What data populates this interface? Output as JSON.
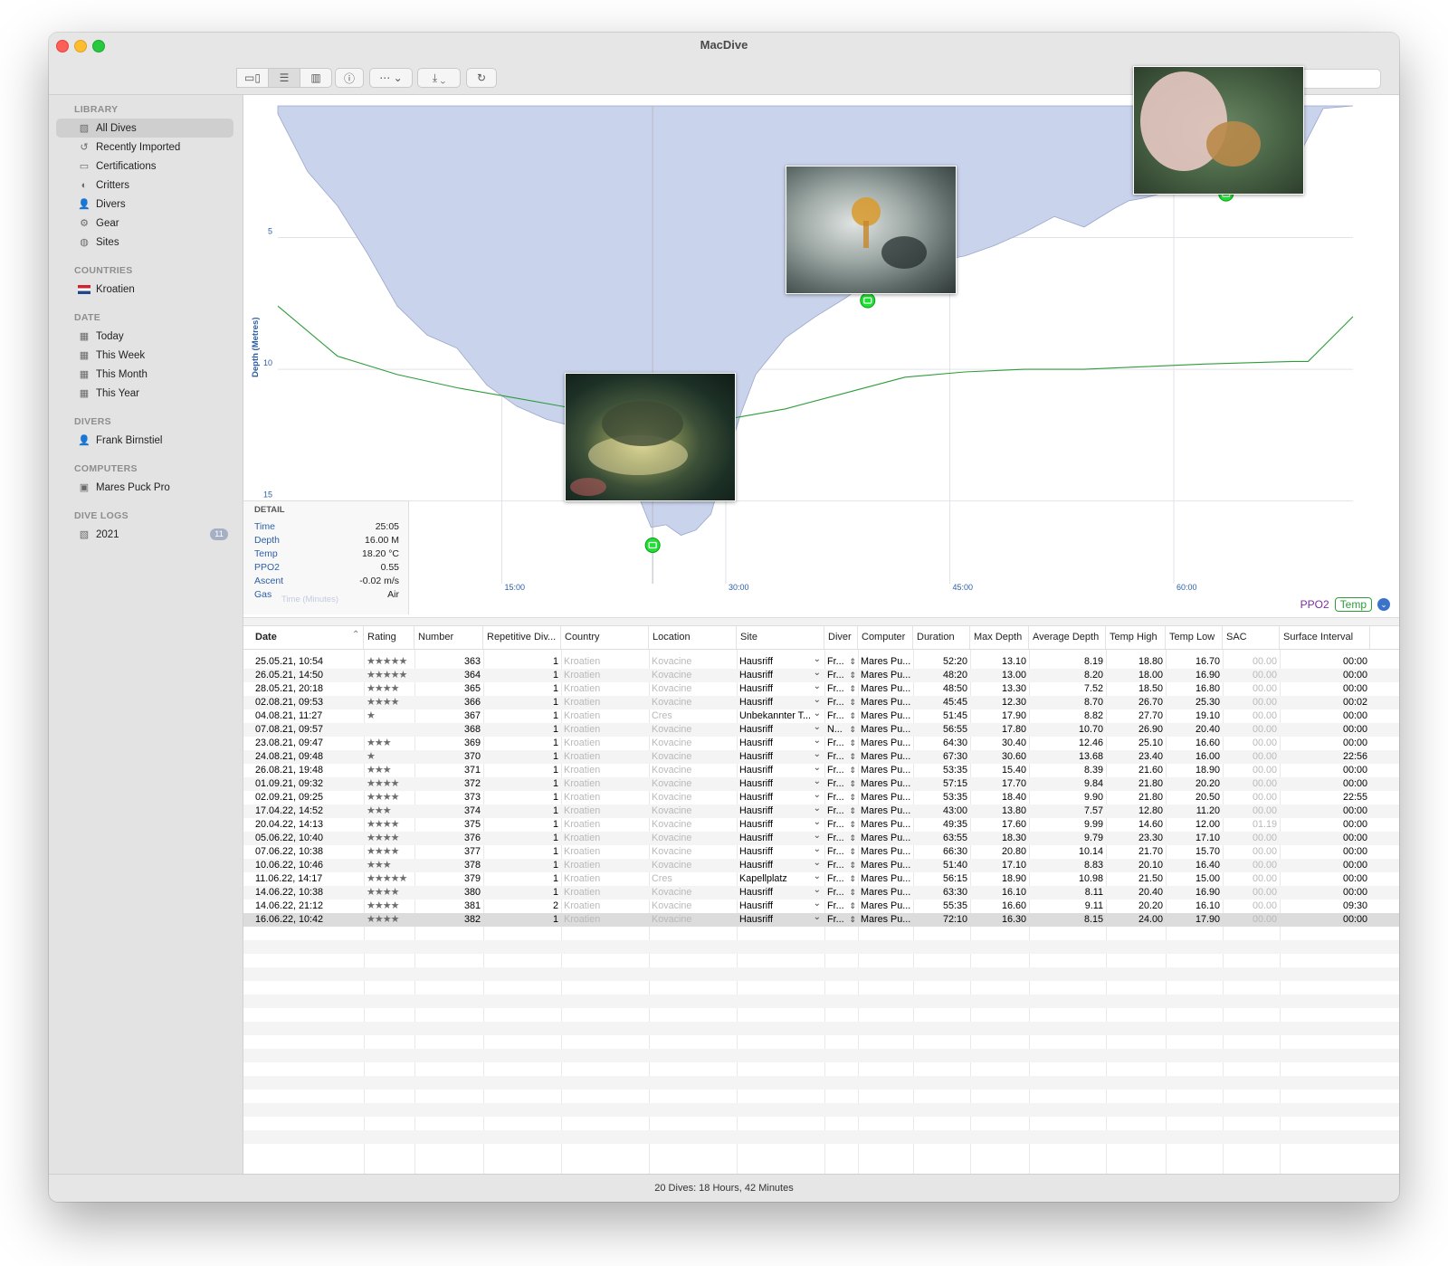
{
  "window": {
    "title": "MacDive"
  },
  "sidebar": {
    "sections": [
      {
        "title": "LIBRARY",
        "items": [
          {
            "label": "All Dives",
            "icon": "book-icon",
            "selected": true
          },
          {
            "label": "Recently Imported",
            "icon": "import-icon"
          },
          {
            "label": "Certifications",
            "icon": "card-icon"
          },
          {
            "label": "Critters",
            "icon": "fish-icon"
          },
          {
            "label": "Divers",
            "icon": "person-icon"
          },
          {
            "label": "Gear",
            "icon": "gear-icon"
          },
          {
            "label": "Sites",
            "icon": "globe-icon"
          }
        ]
      },
      {
        "title": "COUNTRIES",
        "items": [
          {
            "label": "Kroatien",
            "icon": "flag-icon"
          }
        ]
      },
      {
        "title": "DATE",
        "items": [
          {
            "label": "Today",
            "icon": "calendar-icon"
          },
          {
            "label": "This Week",
            "icon": "calendar-icon"
          },
          {
            "label": "This Month",
            "icon": "calendar-icon"
          },
          {
            "label": "This Year",
            "icon": "calendar-icon"
          }
        ]
      },
      {
        "title": "DIVERS",
        "items": [
          {
            "label": "Frank Birnstiel",
            "icon": "person-icon"
          }
        ]
      },
      {
        "title": "COMPUTERS",
        "items": [
          {
            "label": "Mares Puck Pro",
            "icon": "dive-computer-icon"
          }
        ]
      },
      {
        "title": "DIVE LOGS",
        "items": [
          {
            "label": "2021",
            "icon": "book-icon",
            "badge": "11"
          }
        ]
      }
    ]
  },
  "chart": {
    "ylabel": "Depth (Metres)",
    "xlabel": "Time (Minutes)",
    "legend": {
      "ppo2": "PPO2",
      "temp": "Temp"
    }
  },
  "chart_data": {
    "type": "area",
    "xlabel": "Time (Minutes)",
    "ylabel": "Depth (Metres)",
    "x_ticks": [
      "15:00",
      "30:00",
      "45:00",
      "60:00"
    ],
    "x_range": [
      0,
      72
    ],
    "y_ticks": [
      "5",
      "10",
      "15"
    ],
    "y_range": [
      0,
      18
    ],
    "y_inverted": true,
    "series": [
      {
        "name": "Depth",
        "color": "#c9d3ec",
        "x": [
          0,
          2,
          4,
          6,
          8,
          10,
          12,
          14,
          16,
          18,
          20,
          22,
          24,
          25,
          26,
          27,
          28,
          29,
          30,
          31,
          32,
          34,
          36,
          38,
          40,
          42,
          44,
          46,
          48,
          50,
          52,
          54,
          56,
          57,
          58,
          60,
          62,
          64,
          66,
          68,
          70,
          72
        ],
        "y": [
          0.3,
          2.5,
          3.8,
          5.6,
          7.6,
          8.7,
          9.2,
          10.6,
          11.4,
          11.9,
          12.2,
          12.6,
          14.6,
          16.0,
          15.9,
          16.3,
          16.1,
          15.5,
          13.5,
          11.7,
          10.2,
          8.8,
          8.0,
          7.3,
          6.5,
          6.2,
          5.9,
          5.7,
          5.3,
          4.8,
          4.2,
          4.6,
          3.9,
          3.6,
          3.5,
          3.2,
          2.8,
          2.6,
          2.4,
          2.3,
          0.1,
          0.0
        ]
      },
      {
        "name": "Temp",
        "color": "#2e9c3a",
        "x": [
          0,
          4,
          8,
          12,
          16,
          20,
          24,
          28,
          30,
          34,
          38,
          42,
          46,
          50,
          54,
          58,
          62,
          68,
          69,
          72
        ],
        "y": [
          7.6,
          9.5,
          10.2,
          10.7,
          11.1,
          11.5,
          11.8,
          11.9,
          11.9,
          11.5,
          10.9,
          10.3,
          10.1,
          10.0,
          10.0,
          9.9,
          9.8,
          9.7,
          9.7,
          8.0
        ]
      }
    ],
    "cursor_x": 25.1,
    "photo_markers_x": [
      25.1,
      39.5,
      63.5
    ]
  },
  "detail": {
    "title": "DETAIL",
    "rows": [
      {
        "k": "Time",
        "v": "25:05"
      },
      {
        "k": "Depth",
        "v": "16.00 M"
      },
      {
        "k": "Temp",
        "v": "18.20 °C"
      },
      {
        "k": "PPO2",
        "v": "0.55"
      },
      {
        "k": "Ascent",
        "v": "-0.02 m/s"
      },
      {
        "k": "Gas",
        "v": "Air"
      }
    ]
  },
  "table": {
    "columns": [
      "Date",
      "Rating",
      "Number",
      "Repetitive Div...",
      "Country",
      "Location",
      "Site",
      "Diver",
      "Computer",
      "Duration",
      "Max Depth",
      "Average Depth",
      "Temp High",
      "Temp Low",
      "SAC",
      "Surface Interval"
    ],
    "rows": [
      [
        "25.05.21, 10:54",
        "★★★★★",
        "363",
        "1",
        "Kroatien",
        "Kovacine",
        "Hausriff",
        "Fr...",
        "Mares Pu...",
        "52:20",
        "13.10",
        "8.19",
        "18.80",
        "16.70",
        "00.00",
        "00:00"
      ],
      [
        "26.05.21, 14:50",
        "★★★★★",
        "364",
        "1",
        "Kroatien",
        "Kovacine",
        "Hausriff",
        "Fr...",
        "Mares Pu...",
        "48:20",
        "13.00",
        "8.20",
        "18.00",
        "16.90",
        "00.00",
        "00:00"
      ],
      [
        "28.05.21, 20:18",
        "★★★★",
        "365",
        "1",
        "Kroatien",
        "Kovacine",
        "Hausriff",
        "Fr...",
        "Mares Pu...",
        "48:50",
        "13.30",
        "7.52",
        "18.50",
        "16.80",
        "00.00",
        "00:00"
      ],
      [
        "02.08.21, 09:53",
        "★★★★",
        "366",
        "1",
        "Kroatien",
        "Kovacine",
        "Hausriff",
        "Fr...",
        "Mares Pu...",
        "45:45",
        "12.30",
        "8.70",
        "26.70",
        "25.30",
        "00.00",
        "00:02"
      ],
      [
        "04.08.21, 11:27",
        "★",
        "367",
        "1",
        "Kroatien",
        "Cres",
        "Unbekannter T...",
        "Fr...",
        "Mares Pu...",
        "51:45",
        "17.90",
        "8.82",
        "27.70",
        "19.10",
        "00.00",
        "00:00"
      ],
      [
        "07.08.21, 09:57",
        "",
        "368",
        "1",
        "Kroatien",
        "Kovacine",
        "Hausriff",
        "N...",
        "Mares Pu...",
        "56:55",
        "17.80",
        "10.70",
        "26.90",
        "20.40",
        "00.00",
        "00:00"
      ],
      [
        "23.08.21, 09:47",
        "★★★",
        "369",
        "1",
        "Kroatien",
        "Kovacine",
        "Hausriff",
        "Fr...",
        "Mares Pu...",
        "64:30",
        "30.40",
        "12.46",
        "25.10",
        "16.60",
        "00.00",
        "00:00"
      ],
      [
        "24.08.21, 09:48",
        "★",
        "370",
        "1",
        "Kroatien",
        "Kovacine",
        "Hausriff",
        "Fr...",
        "Mares Pu...",
        "67:30",
        "30.60",
        "13.68",
        "23.40",
        "16.00",
        "00.00",
        "22:56"
      ],
      [
        "26.08.21, 19:48",
        "★★★",
        "371",
        "1",
        "Kroatien",
        "Kovacine",
        "Hausriff",
        "Fr...",
        "Mares Pu...",
        "53:35",
        "15.40",
        "8.39",
        "21.60",
        "18.90",
        "00.00",
        "00:00"
      ],
      [
        "01.09.21, 09:32",
        "★★★★",
        "372",
        "1",
        "Kroatien",
        "Kovacine",
        "Hausriff",
        "Fr...",
        "Mares Pu...",
        "57:15",
        "17.70",
        "9.84",
        "21.80",
        "20.20",
        "00.00",
        "00:00"
      ],
      [
        "02.09.21, 09:25",
        "★★★★",
        "373",
        "1",
        "Kroatien",
        "Kovacine",
        "Hausriff",
        "Fr...",
        "Mares Pu...",
        "53:35",
        "18.40",
        "9.90",
        "21.80",
        "20.50",
        "00.00",
        "22:55"
      ],
      [
        "17.04.22, 14:52",
        "★★★",
        "374",
        "1",
        "Kroatien",
        "Kovacine",
        "Hausriff",
        "Fr...",
        "Mares Pu...",
        "43:00",
        "13.80",
        "7.57",
        "12.80",
        "11.20",
        "00.00",
        "00:00"
      ],
      [
        "20.04.22, 14:13",
        "★★★★",
        "375",
        "1",
        "Kroatien",
        "Kovacine",
        "Hausriff",
        "Fr...",
        "Mares Pu...",
        "49:35",
        "17.60",
        "9.99",
        "14.60",
        "12.00",
        "01.19",
        "00:00"
      ],
      [
        "05.06.22, 10:40",
        "★★★★",
        "376",
        "1",
        "Kroatien",
        "Kovacine",
        "Hausriff",
        "Fr...",
        "Mares Pu...",
        "63:55",
        "18.30",
        "9.79",
        "23.30",
        "17.10",
        "00.00",
        "00:00"
      ],
      [
        "07.06.22, 10:38",
        "★★★★",
        "377",
        "1",
        "Kroatien",
        "Kovacine",
        "Hausriff",
        "Fr...",
        "Mares Pu...",
        "66:30",
        "20.80",
        "10.14",
        "21.70",
        "15.70",
        "00.00",
        "00:00"
      ],
      [
        "10.06.22, 10:46",
        "★★★",
        "378",
        "1",
        "Kroatien",
        "Kovacine",
        "Hausriff",
        "Fr...",
        "Mares Pu...",
        "51:40",
        "17.10",
        "8.83",
        "20.10",
        "16.40",
        "00.00",
        "00:00"
      ],
      [
        "11.06.22, 14:17",
        "★★★★★",
        "379",
        "1",
        "Kroatien",
        "Cres",
        "Kapellplatz",
        "Fr...",
        "Mares Pu...",
        "56:15",
        "18.90",
        "10.98",
        "21.50",
        "15.00",
        "00.00",
        "00:00"
      ],
      [
        "14.06.22, 10:38",
        "★★★★",
        "380",
        "1",
        "Kroatien",
        "Kovacine",
        "Hausriff",
        "Fr...",
        "Mares Pu...",
        "63:30",
        "16.10",
        "8.11",
        "20.40",
        "16.90",
        "00.00",
        "00:00"
      ],
      [
        "14.06.22, 21:12",
        "★★★★",
        "381",
        "2",
        "Kroatien",
        "Kovacine",
        "Hausriff",
        "Fr...",
        "Mares Pu...",
        "55:35",
        "16.60",
        "9.11",
        "20.20",
        "16.10",
        "00.00",
        "09:30"
      ],
      [
        "16.06.22, 10:42",
        "★★★★",
        "382",
        "1",
        "Kroatien",
        "Kovacine",
        "Hausriff",
        "Fr...",
        "Mares Pu...",
        "72:10",
        "16.30",
        "8.15",
        "24.00",
        "17.90",
        "00.00",
        "00:00"
      ]
    ],
    "selected_row": 19
  },
  "status": {
    "summary": "20 Dives: 18 Hours, 42 Minutes"
  },
  "colors": {
    "depth_fill": "#c9d3ec",
    "temp_line": "#2e9c3a",
    "marker": "#22e033"
  }
}
